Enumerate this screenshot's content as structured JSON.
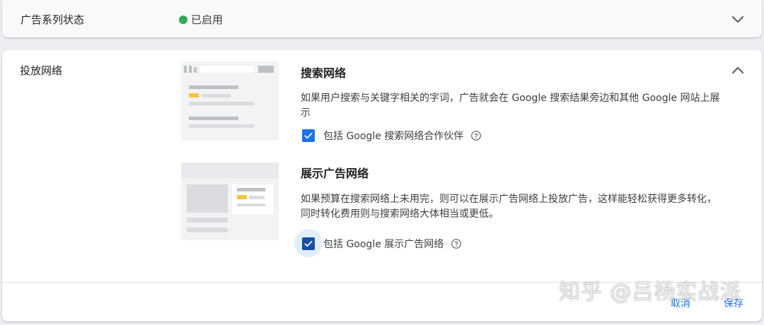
{
  "campaign_status": {
    "label": "广告系列状态",
    "value": "已启用",
    "dot_color": "#34a853"
  },
  "network": {
    "label": "投放网络",
    "search": {
      "title": "搜索网络",
      "description": "如果用户搜索与关键字相关的字词，广告就会在 Google 搜索结果旁边和其他 Google 网站上展示",
      "checkbox_label": "包括 Google 搜索网络合作伙伴",
      "checked": true
    },
    "display": {
      "title": "展示广告网络",
      "description": "如果预算在搜索网络上未用完，则可以在展示广告网络上投放广告，这样能轻松获得更多转化，同时转化费用则与搜索网络大体相当或更低。",
      "checkbox_label": "包括 Google 展示广告网络",
      "checked": true
    }
  },
  "actions": {
    "cancel": "取消",
    "save": "保存"
  },
  "watermark": "知乎 @吕杨实战派",
  "colors": {
    "accent": "#1a73e8",
    "checkbox_focused": "#174ea6",
    "highlight": "#f6c344"
  },
  "icons": {
    "expand": "chevron-down-icon",
    "collapse": "chevron-up-icon",
    "help": "help-circle-icon",
    "check": "check-icon"
  }
}
